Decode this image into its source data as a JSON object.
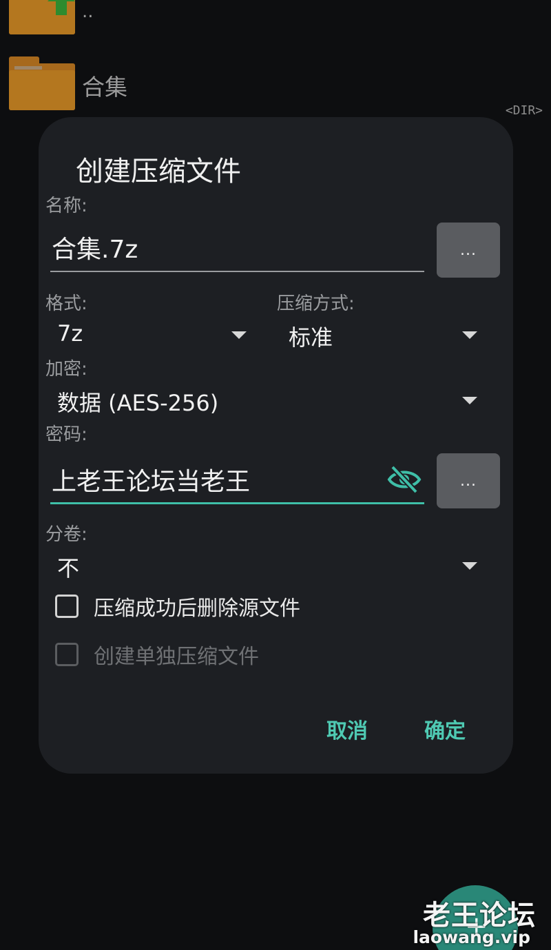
{
  "file_list": {
    "parent_dir_label": "..",
    "folder_name": "合集",
    "dir_tag": "<DIR>"
  },
  "dialog": {
    "title": "创建压缩文件",
    "name_label": "名称:",
    "name_value": "合集.7z",
    "name_browse": "...",
    "format_label": "格式:",
    "format_value": "7z",
    "method_label": "压缩方式:",
    "method_value": "标准",
    "encrypt_label": "加密:",
    "encrypt_value": "数据 (AES-256)",
    "password_label": "密码:",
    "password_value": "上老王论坛当老王",
    "password_browse": "...",
    "split_label": "分卷:",
    "split_value": "不",
    "delete_after_label": "压缩成功后删除源文件",
    "delete_after_checked": false,
    "separate_archive_label": "创建单独压缩文件",
    "separate_archive_checked": false,
    "cancel_label": "取消",
    "ok_label": "确定"
  },
  "watermark": {
    "title": "老王论坛",
    "url": "laowang.vip"
  },
  "fab": {
    "icon": "plus-icon"
  },
  "colors": {
    "accent": "#4fcab3",
    "dialog_bg": "#1d1f23",
    "folder": "#b4771f"
  }
}
